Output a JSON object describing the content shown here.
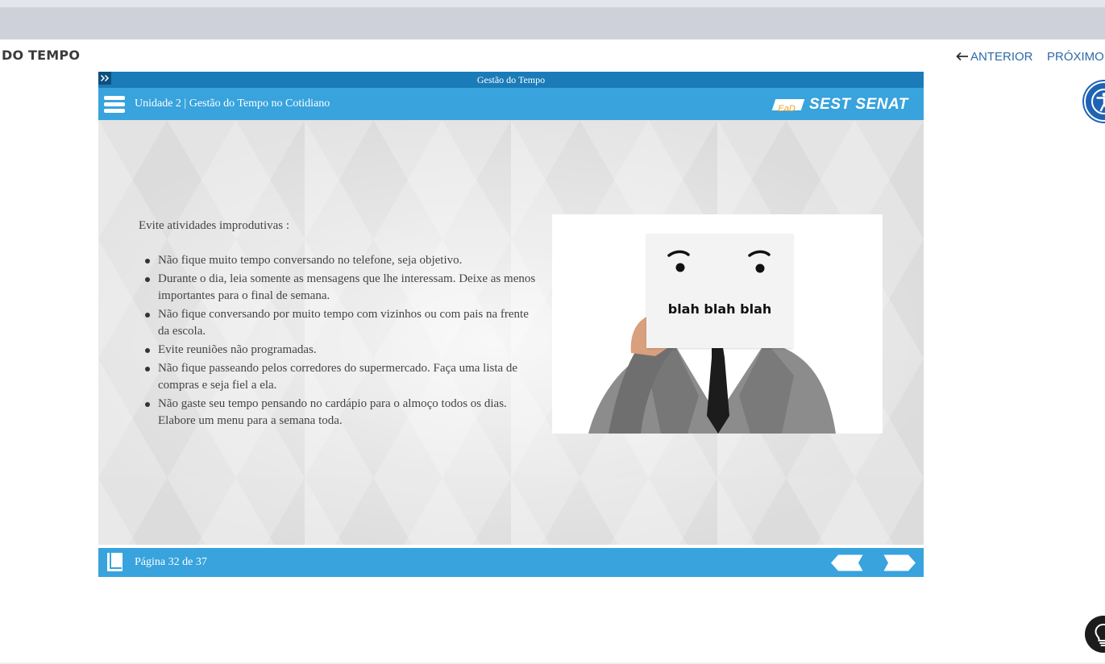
{
  "page": {
    "heading": "DO TEMPO",
    "nav_prev": "ANTERIOR",
    "nav_next": "PRÓXIMO"
  },
  "player": {
    "window_title": "Gestão do Tempo",
    "unit_title": "Unidade 2 | Gestão do Tempo no Cotidiano",
    "logo": {
      "ead": "EaD",
      "brand": "SEST SENAT"
    },
    "intro": "Evite atividades improdutivas :",
    "tips": [
      "Não fique muito tempo conversando no telefone, seja objetivo.",
      "Durante o dia, leia somente as mensagens que lhe interessam. Deixe as menos importantes para o final de semana.",
      "Não fique conversando por muito tempo com vizinhos ou com pais na frente da escola.",
      "Evite reuniões não programadas.",
      "Não fique passeando pelos corredores do supermercado. Faça uma lista de compras e seja fiel a ela.",
      "Não gaste seu tempo pensando no cardápio para o almoço todos os dias. Elabore um menu para a semana toda."
    ],
    "image_sign_text": "blah blah blah",
    "page_indicator": "Página 32 de 37"
  },
  "colors": {
    "header_blue": "#38a3dd",
    "titlebar_blue": "#1b7bb9",
    "link_blue": "#2e6aa6",
    "accessibility_blue": "#1f63b5"
  },
  "icons": {
    "menu": "hamburger-icon",
    "expand": "double-chevron-right-icon",
    "book": "book-icon",
    "prev": "arrow-left-icon",
    "next": "arrow-right-icon",
    "accessibility": "accessibility-icon",
    "hint": "lightbulb-icon"
  }
}
